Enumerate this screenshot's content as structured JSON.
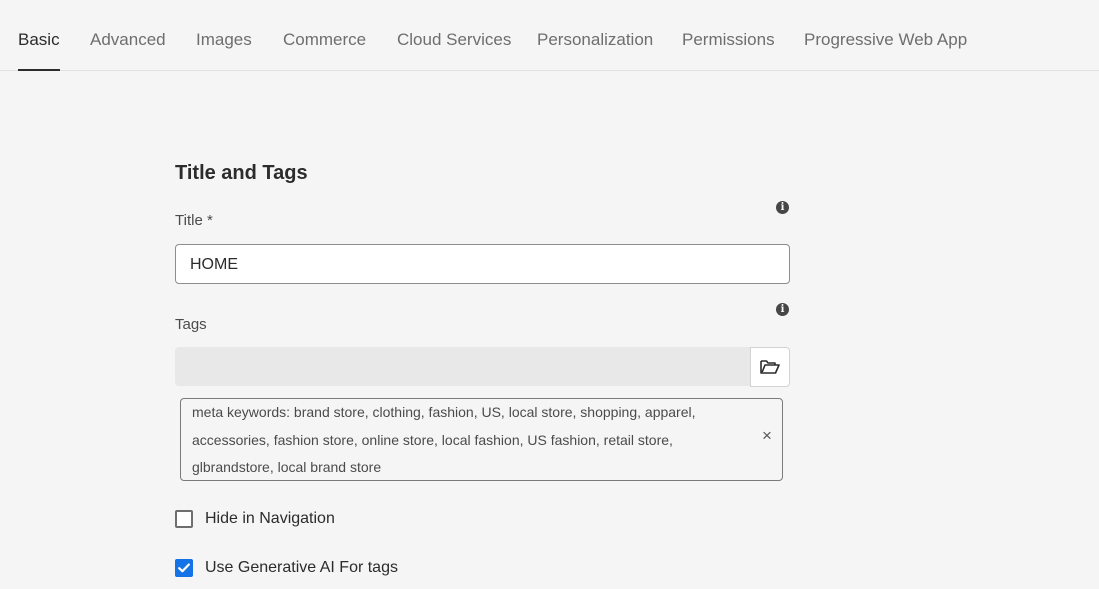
{
  "tabs": [
    {
      "label": "Basic",
      "active": true
    },
    {
      "label": "Advanced",
      "active": false
    },
    {
      "label": "Images",
      "active": false
    },
    {
      "label": "Commerce",
      "active": false
    },
    {
      "label": "Cloud Services",
      "active": false
    },
    {
      "label": "Personalization",
      "active": false
    },
    {
      "label": "Permissions",
      "active": false
    },
    {
      "label": "Progressive Web App",
      "active": false
    }
  ],
  "section": {
    "title": "Title and Tags"
  },
  "title_field": {
    "label": "Title *",
    "value": "HOME",
    "info_icon": "info-icon"
  },
  "tags_field": {
    "label": "Tags",
    "value": "",
    "info_icon": "info-icon",
    "picker_icon": "folder-open-icon",
    "selected_tag": "meta keywords: brand store, clothing, fashion, US, local store, shopping, apparel, accessories, fashion store, online store, local fashion, US fashion, retail store, glbrandstore, local brand store",
    "remove_icon": "close-icon"
  },
  "checkboxes": [
    {
      "label": "Hide in Navigation",
      "checked": false
    },
    {
      "label": "Use Generative AI For tags",
      "checked": true
    }
  ],
  "colors": {
    "background": "#f5f5f5",
    "accent": "#1473e6",
    "text": "#2c2c2c"
  }
}
